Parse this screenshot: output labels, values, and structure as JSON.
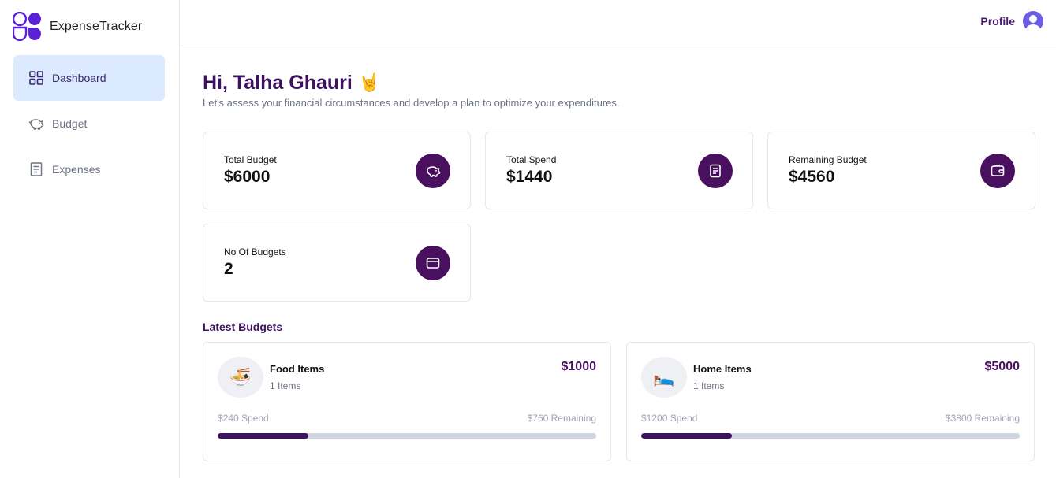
{
  "app": {
    "name": "ExpenseTracker"
  },
  "sidebar": {
    "items": [
      {
        "label": "Dashboard",
        "icon": "dashboard-grid-icon",
        "active": true
      },
      {
        "label": "Budget",
        "icon": "piggy-bank-icon",
        "active": false
      },
      {
        "label": "Expenses",
        "icon": "receipt-icon",
        "active": false
      }
    ]
  },
  "header": {
    "profile_label": "Profile",
    "avatar_icon": "user-avatar-icon"
  },
  "main": {
    "greeting": "Hi, Talha Ghauri",
    "greeting_emoji": "🤘",
    "subtitle": "Let's assess your financial circumstances and develop a plan to optimize your expenditures."
  },
  "stats": [
    {
      "label": "Total Budget",
      "value": "$6000",
      "icon": "piggy-bank-icon"
    },
    {
      "label": "Total Spend",
      "value": "$1440",
      "icon": "receipt-icon"
    },
    {
      "label": "Remaining Budget",
      "value": "$4560",
      "icon": "wallet-icon"
    },
    {
      "label": "No Of Budgets",
      "value": "2",
      "icon": "wallet-icon"
    }
  ],
  "latest_budgets": {
    "title": "Latest Budgets",
    "items": [
      {
        "emoji": "🍜",
        "name": "Food Items",
        "count": "1 Items",
        "amount": "$1000",
        "spend": "$240 Spend",
        "remaining": "$760 Remaining",
        "progress": 0.24
      },
      {
        "emoji": "🛌",
        "name": "Home Items",
        "count": "1 Items",
        "amount": "$5000",
        "spend": "$1200 Spend",
        "remaining": "$3800 Remaining",
        "progress": 0.24
      }
    ]
  },
  "colors": {
    "accent": "#4a1060",
    "active_nav_bg": "#dbeafe",
    "progress_track": "#cfd5e1"
  }
}
